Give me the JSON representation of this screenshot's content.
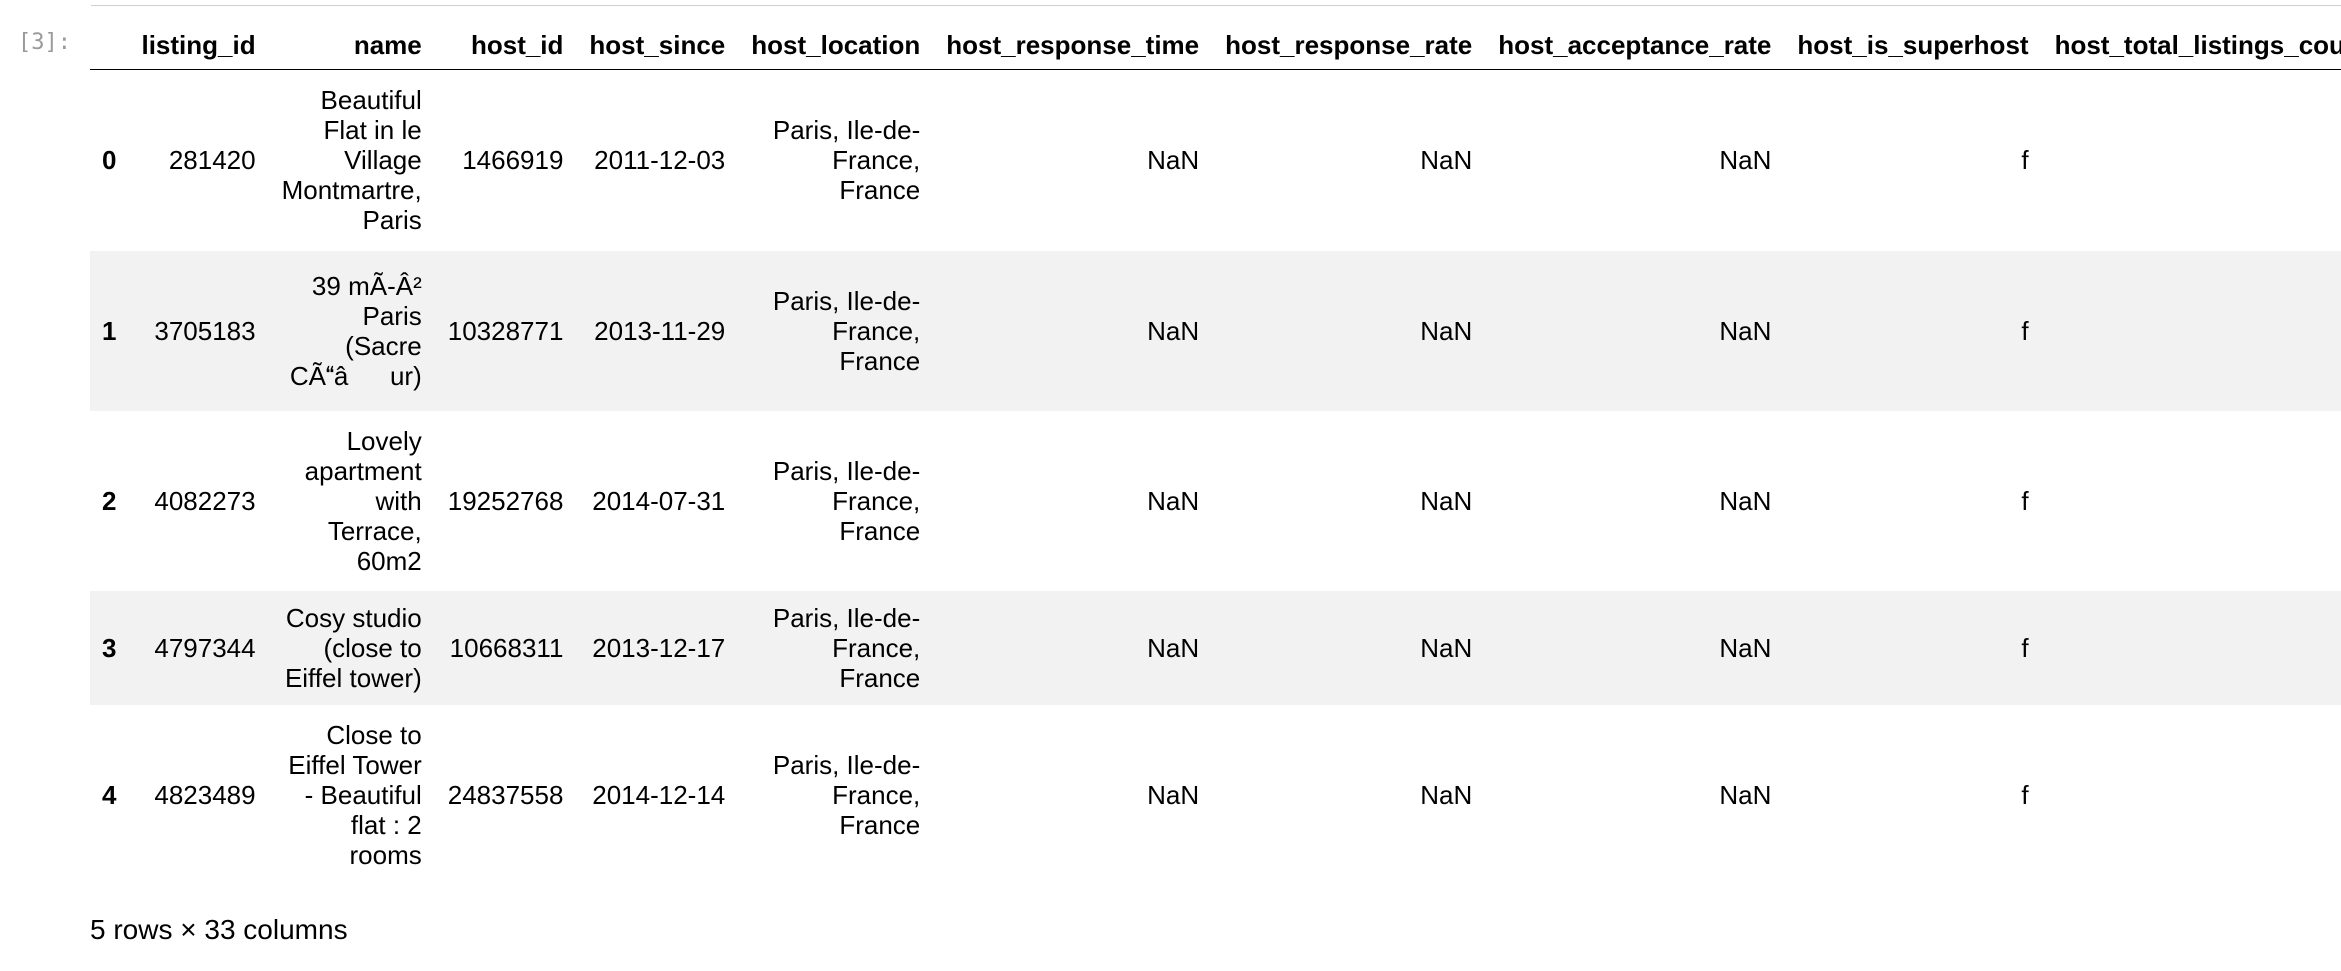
{
  "prompt": "[3]:",
  "table": {
    "columns": [
      "",
      "listing_id",
      "name",
      "host_id",
      "host_since",
      "host_location",
      "host_response_time",
      "host_response_rate",
      "host_acceptance_rate",
      "host_is_superhost",
      "host_total_listings_count"
    ],
    "rows": [
      [
        "0",
        "281420",
        "Beautiful Flat in le Village Montmartre, Paris",
        "1466919",
        "2011-12-03",
        "Paris, Ile-de-France, France",
        "NaN",
        "NaN",
        "NaN",
        "f",
        ""
      ],
      [
        "1",
        "3705183",
        "39 mÃ-Â² Paris (Sacre CÃâur)",
        "10328771",
        "2013-11-29",
        "Paris, Ile-de-France, France",
        "NaN",
        "NaN",
        "NaN",
        "f",
        ""
      ],
      [
        "2",
        "4082273",
        "Lovely apartment with Terrace, 60m2",
        "19252768",
        "2014-07-31",
        "Paris, Ile-de-France, France",
        "NaN",
        "NaN",
        "NaN",
        "f",
        ""
      ],
      [
        "3",
        "4797344",
        "Cosy studio (close to Eiffel tower)",
        "10668311",
        "2013-12-17",
        "Paris, Ile-de-France, France",
        "NaN",
        "NaN",
        "NaN",
        "f",
        ""
      ],
      [
        "4",
        "4823489",
        "Close to Eiffel Tower - Beautiful flat : 2 rooms",
        "24837558",
        "2014-12-14",
        "Paris, Ile-de-France, France",
        "NaN",
        "NaN",
        "NaN",
        "f",
        ""
      ]
    ]
  },
  "footer": "5 rows × 33 columns"
}
